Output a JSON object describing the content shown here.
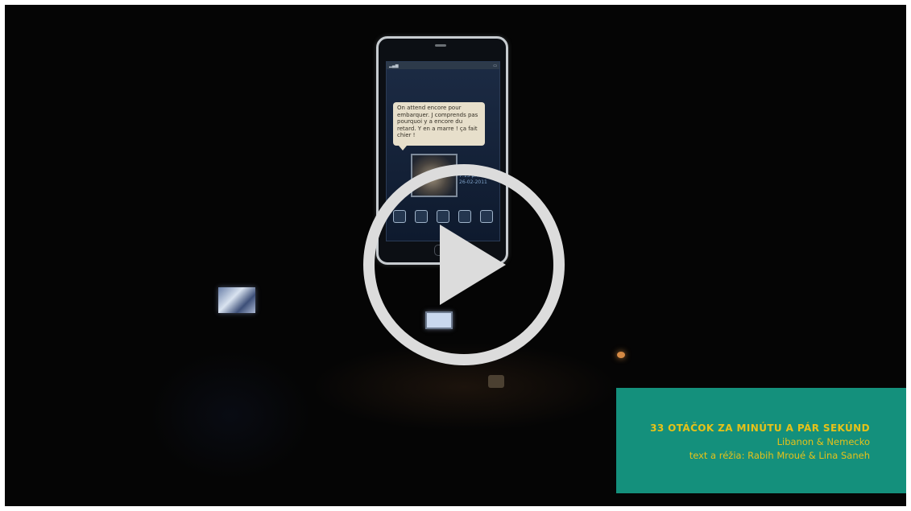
{
  "video": {
    "caption": {
      "title": "33 OTÁČOK ZA MINÚTU A PÁR SEKÚND",
      "country": "Libanon & Nemecko",
      "credits": "text a réžia: Rabih Mroué & Lina Saneh"
    },
    "phone_screen": {
      "message": "On attend encore pour embarquer. J comprends pas pourquoi y a encore du retard. Y en a marre ! ça fait chier !",
      "photo_meta": [
        "Samedi",
        "7:15 pm",
        "26-02-2011"
      ]
    },
    "play_icon": "play-icon"
  },
  "colors": {
    "caption_bg": "#14907c",
    "caption_text": "#e6c219",
    "player_bg": "#050505",
    "play_button": "#dcdcdc"
  }
}
